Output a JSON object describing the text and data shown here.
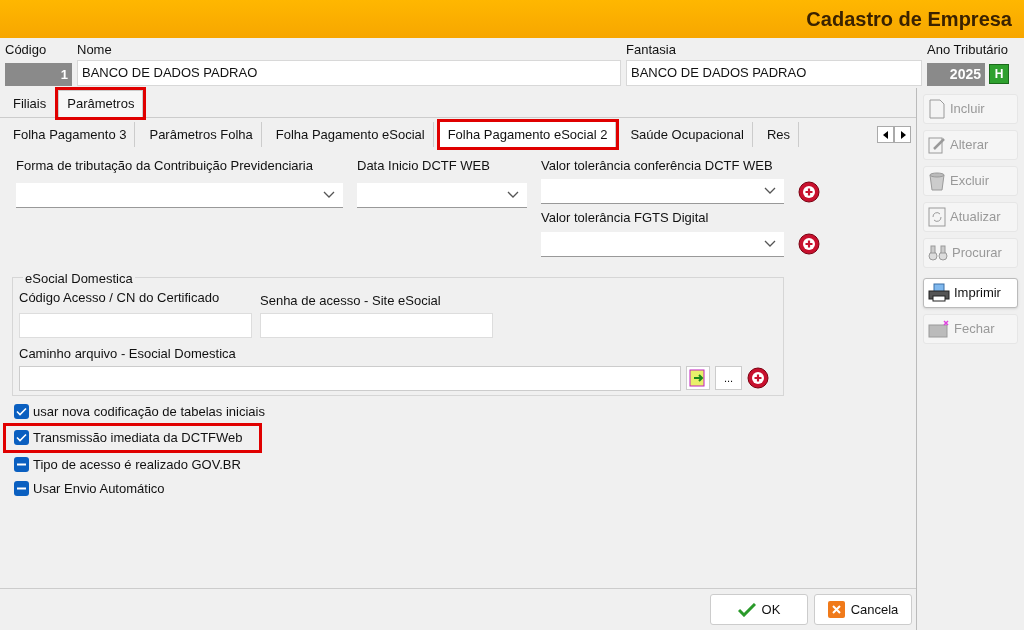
{
  "window": {
    "title": "Cadastro de Empresa"
  },
  "header": {
    "codigo": {
      "label": "Código",
      "value": "1"
    },
    "nome": {
      "label": "Nome",
      "value": "BANCO DE DADOS PADRAO"
    },
    "fantasia": {
      "label": "Fantasia",
      "value": "BANCO DE DADOS PADRAO"
    },
    "ano": {
      "label": "Ano Tributário",
      "value": "2025",
      "button": "H"
    }
  },
  "tabs": [
    {
      "label": "Filiais",
      "selected": false,
      "highlighted": false
    },
    {
      "label": "Parâmetros",
      "selected": true,
      "highlighted": true
    }
  ],
  "subtabs": [
    {
      "label": "Folha Pagamento 3",
      "selected": false,
      "highlighted": false
    },
    {
      "label": "Parâmetros Folha",
      "selected": false,
      "highlighted": false
    },
    {
      "label": "Folha Pagamento eSocial",
      "selected": false,
      "highlighted": false
    },
    {
      "label": "Folha Pagamento eSocial 2",
      "selected": true,
      "highlighted": true
    },
    {
      "label": "Saúde Ocupacional",
      "selected": false,
      "highlighted": false
    },
    {
      "label": "Res",
      "selected": false,
      "highlighted": false
    }
  ],
  "dropdowns": [
    {
      "label": "Forma de tributação da Contribuição Previdenciaria"
    },
    {
      "label": "Data Inicio DCTF WEB"
    },
    {
      "label": "Valor tolerância conferência DCTF WEB"
    },
    {
      "label": "Valor tolerância FGTS Digital"
    }
  ],
  "group": {
    "title": "eSocial Domestica",
    "fields": [
      {
        "label": "Código Acesso / CN do Certificado"
      },
      {
        "label": "Senha de acesso - Site eSocial"
      }
    ],
    "path": {
      "label": "Caminho arquivo - Esocial Domestica",
      "browse": "..."
    }
  },
  "checkboxes": [
    {
      "label": "usar nova codificação de tabelas iniciais",
      "checked": true,
      "highlighted": false
    },
    {
      "label": "Transmissão imediata da DCTFWeb",
      "checked": true,
      "highlighted": true
    },
    {
      "label": "Tipo de acesso é realizado GOV.BR",
      "checked": false,
      "highlighted": false
    },
    {
      "label": "Usar Envio Automático",
      "checked": false,
      "highlighted": false
    }
  ],
  "toolbar": [
    {
      "label": "Incluir",
      "kind": "page",
      "enabled": false
    },
    {
      "label": "Alterar",
      "kind": "edit",
      "enabled": false
    },
    {
      "label": "Excluir",
      "kind": "bin",
      "enabled": false
    },
    {
      "label": "Atualizar",
      "kind": "refresh",
      "enabled": false
    },
    {
      "label": "Procurar",
      "kind": "binoculars",
      "enabled": false
    },
    {
      "label": "Imprimir",
      "kind": "printer",
      "enabled": true
    },
    {
      "label": "Fechar",
      "kind": "close",
      "enabled": false
    }
  ],
  "footer": [
    {
      "label": "OK",
      "kind": "ok"
    },
    {
      "label": "Cancela",
      "kind": "cancel"
    }
  ]
}
